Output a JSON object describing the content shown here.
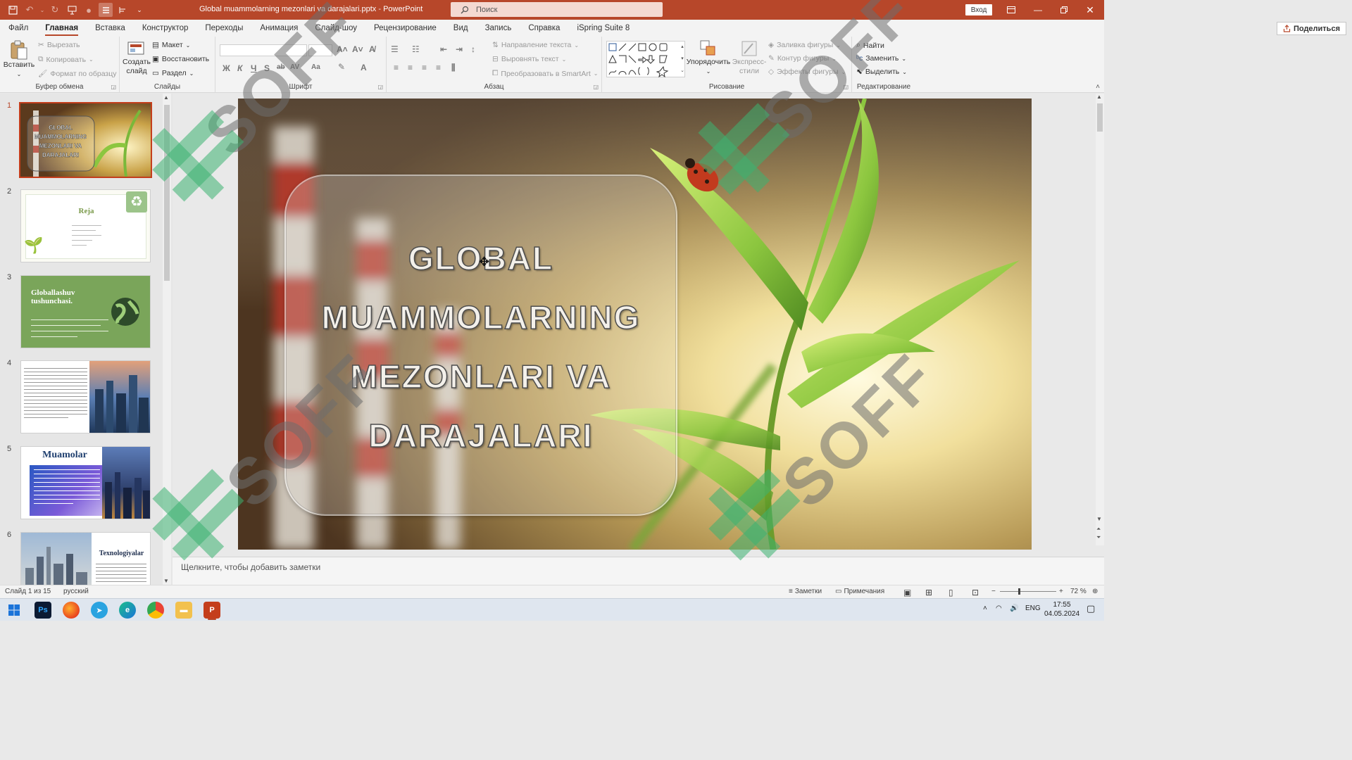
{
  "titlebar": {
    "filename": "Global muammolarning mezonlari va darajalari.pptx",
    "separator": "-",
    "app_name": "PowerPoint",
    "search_placeholder": "Поиск",
    "login_label": "Вход"
  },
  "tabs": [
    "Файл",
    "Главная",
    "Вставка",
    "Конструктор",
    "Переходы",
    "Анимация",
    "Слайд-шоу",
    "Рецензирование",
    "Вид",
    "Запись",
    "Справка",
    "iSpring Suite 8"
  ],
  "share_label": "Поделиться",
  "ribbon": {
    "clipboard": {
      "paste": "Вставить",
      "cut": "Вырезать",
      "copy": "Копировать",
      "format_painter": "Формат по образцу",
      "label": "Буфер обмена"
    },
    "slides": {
      "new_slide_line1": "Создать",
      "new_slide_line2": "слайд",
      "layout": "Макет",
      "reset": "Восстановить",
      "section": "Раздел",
      "label": "Слайды"
    },
    "font": {
      "bold": "Ж",
      "italic": "К",
      "underline": "Ч",
      "shadow": "S",
      "strike": "ab",
      "spacing": "AV",
      "case": "Aa",
      "font_color": "A",
      "label": "Шрифт"
    },
    "paragraph": {
      "text_direction": "Направление текста",
      "align_text": "Выровнять текст",
      "smartart": "Преобразовать в SmartArt",
      "label": "Абзац"
    },
    "drawing": {
      "arrange": "Упорядочить",
      "quick_styles_line1": "Экспресс-",
      "quick_styles_line2": "стили",
      "shape_fill": "Заливка фигуры",
      "shape_outline": "Контур фигуры",
      "shape_effects": "Эффекты фигуры",
      "label": "Рисование"
    },
    "editing": {
      "find": "Найти",
      "replace": "Заменить",
      "select": "Выделить",
      "label": "Редактирование"
    }
  },
  "thumbnails": [
    {
      "num": "1",
      "title": "GLOBAL MUAMMOLARNING MEZONLARI VA DARAJALARI"
    },
    {
      "num": "2",
      "title": "Reja"
    },
    {
      "num": "3",
      "title": "Globallashuv tushunchasi."
    },
    {
      "num": "4",
      "title": ""
    },
    {
      "num": "5",
      "title": "Muamolar"
    },
    {
      "num": "6",
      "title": "Texnologiyalar"
    }
  ],
  "slide": {
    "title_lines": [
      "GLOBAL",
      "MUAMMOLARNING",
      "MEZONLARI VA",
      "DARAJALARI"
    ]
  },
  "notes_placeholder": "Щелкните, чтобы добавить заметки",
  "status": {
    "slide_count": "Слайд 1 из 15",
    "language": "русский",
    "notes": "Заметки",
    "comments": "Примечания",
    "zoom": "72 %"
  },
  "tray": {
    "lang": "ENG",
    "time": "17:55",
    "date": "04.05.2024"
  },
  "watermark_text": "SOFF",
  "colors": {
    "accent": "#b7472a",
    "watermark_green": "#3cb371"
  }
}
